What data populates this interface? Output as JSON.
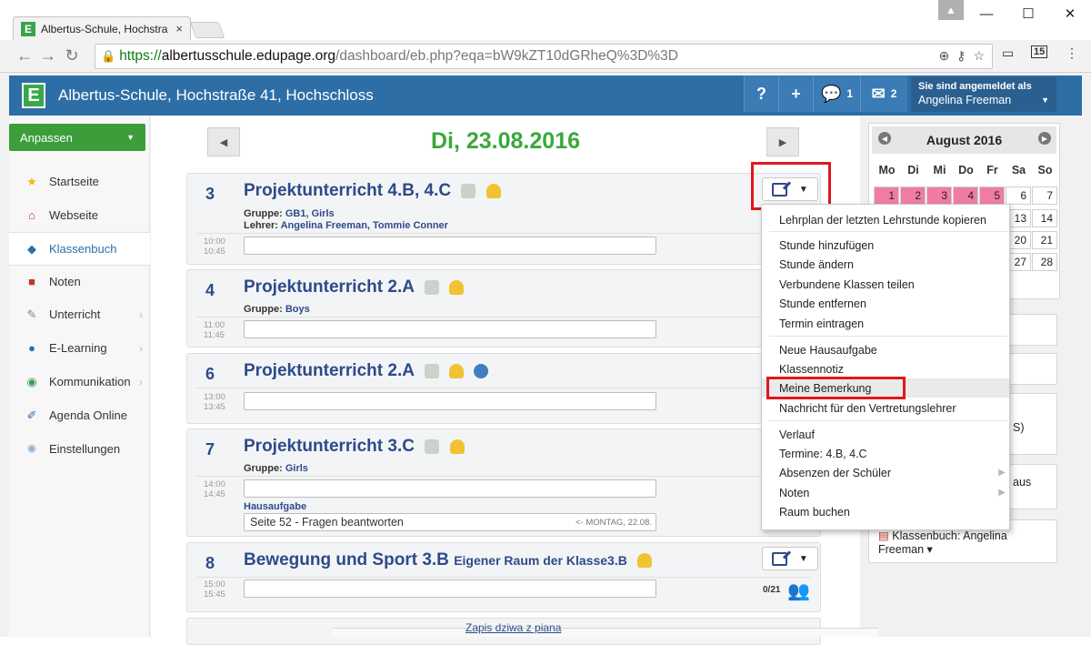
{
  "browser": {
    "tab_title": "Albertus-Schule, Hochstra",
    "tab_close": "×",
    "favicon_letter": "E",
    "window_controls": {
      "minimize": "—",
      "maximize": "☐",
      "close": "✕"
    },
    "url_scheme": "https://",
    "url_host": "albertusschule.edupage.org",
    "url_path": "/dashboard/eb.php?eqa=bW9kZT10dGRheQ%3D%3D",
    "ext_badge": "15"
  },
  "header": {
    "logo_letter": "E",
    "title": "Albertus-Schule, Hochstraße 41, Hochschloss",
    "help_label": "?",
    "add_label": "+",
    "messages_count": "1",
    "mail_count": "2",
    "logged_in_label": "Sie sind angemeldet als",
    "user_name": "Angelina Freeman"
  },
  "sidebar": {
    "customize_label": "Anpassen",
    "items": [
      {
        "label": "Startseite",
        "icon": "star-icon",
        "glyph": "★",
        "color": "#f0b81a"
      },
      {
        "label": "Webseite",
        "icon": "house-icon",
        "glyph": "⌂",
        "color": "#c0392b"
      },
      {
        "label": "Klassenbuch",
        "icon": "book-icon",
        "glyph": "◆",
        "color": "#2e6ea6"
      },
      {
        "label": "Noten",
        "icon": "grades-icon",
        "glyph": "■",
        "color": "#c0392b"
      },
      {
        "label": "Unterricht",
        "icon": "lesson-icon",
        "glyph": "✎",
        "color": "#888"
      },
      {
        "label": "E-Learning",
        "icon": "elearning-icon",
        "glyph": "●",
        "color": "#2e6ea6"
      },
      {
        "label": "Kommunikation",
        "icon": "globe-icon",
        "glyph": "◉",
        "color": "#3a9a5a"
      },
      {
        "label": "Agenda Online",
        "icon": "pen-icon",
        "glyph": "✐",
        "color": "#2e6ea6"
      },
      {
        "label": "Einstellungen",
        "icon": "gear-icon",
        "glyph": "✺",
        "color": "#8fb0cf"
      }
    ]
  },
  "main": {
    "date": "Di, 23.08.2016",
    "prev": "◀",
    "next": "▶",
    "lessons": [
      {
        "num": "3",
        "name": "Projektunterricht",
        "classes": "4.B, 4.C",
        "group_key": "Gruppe:",
        "group_val": "GB1, Girls",
        "teacher_key": "Lehrer:",
        "teacher_val": "Angelina Freeman, Tommie Conner",
        "time_start": "10:00",
        "time_end": "10:45"
      },
      {
        "num": "4",
        "name": "Projektunterricht",
        "classes": "2.A",
        "group_key": "Gruppe:",
        "group_val": "Boys",
        "time_start": "11:00",
        "time_end": "11:45"
      },
      {
        "num": "6",
        "name": "Projektunterricht",
        "classes": "2.A",
        "time_start": "13:00",
        "time_end": "13:45"
      },
      {
        "num": "7",
        "name": "Projektunterricht",
        "classes": "3.C",
        "group_key": "Gruppe:",
        "group_val": "Girls",
        "time_start": "14:00",
        "time_end": "14:45",
        "homework_label": "Hausaufgabe",
        "homework_text": "Seite 52 - Fragen beantworten",
        "homework_due": "<- MONTAG, 22.08."
      },
      {
        "num": "8",
        "name": "Bewegung und Sport",
        "classes": "3.B",
        "room": "Eigener Raum der Klasse3.B",
        "time_start": "15:00",
        "time_end": "15:45",
        "attendance": "0/21"
      }
    ]
  },
  "menu": {
    "items": [
      "Lehrplan der letzten Lehrstunde kopieren",
      "Stunde hinzufügen",
      "Stunde ändern",
      "Verbundene Klassen teilen",
      "Stunde entfernen",
      "Termin eintragen",
      "Neue Hausaufgabe",
      "Klassennotiz",
      "Meine Bemerkung",
      "Nachricht für den Vertretungslehrer",
      "Verlauf",
      "Termine: 4.B, 4.C",
      "Absenzen der Schüler",
      "Noten",
      "Raum buchen"
    ]
  },
  "calendar": {
    "month": "August 2016",
    "dow": [
      "Mo",
      "Di",
      "Mi",
      "Do",
      "Fr",
      "Sa",
      "So"
    ],
    "row1": [
      "1",
      "2",
      "3",
      "4",
      "5",
      "6",
      "7"
    ],
    "row2": [
      "13",
      "14"
    ],
    "row3": [
      "20",
      "21"
    ],
    "row4": [
      "27",
      "28"
    ]
  },
  "right": {
    "box_s": "S)",
    "box_aus": "aus",
    "klassenbuch_line1": "Klassenbuch: Angelina",
    "klassenbuch_line2": "Freeman ▾"
  },
  "footer_link": "Zapis dziwa z piana"
}
